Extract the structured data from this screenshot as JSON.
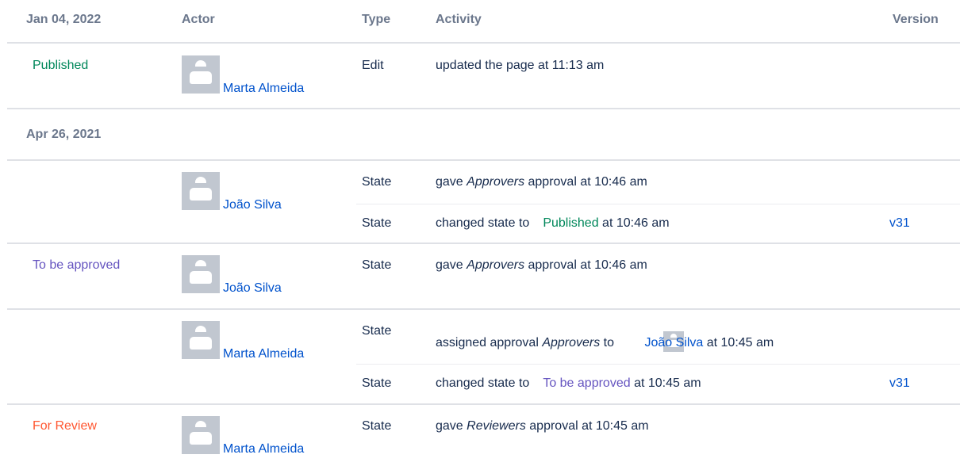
{
  "header": {
    "date": "Jan 04, 2022",
    "actor": "Actor",
    "type": "Type",
    "activity": "Activity",
    "version": "Version"
  },
  "group2_date": "Apr 26, 2021",
  "rows": [
    {
      "status": "Published",
      "actor": "Marta Almeida",
      "type": "Edit",
      "activity": "updated the page at 11:13 am"
    },
    {
      "actor": "João Silva",
      "entries": [
        {
          "type": "State",
          "pre": "gave ",
          "em": "Approvers",
          "post": " approval at 10:46 am"
        },
        {
          "type": "State",
          "pre": "changed state to",
          "state": "Published",
          "post": " at 10:46 am",
          "version": "v31"
        }
      ]
    },
    {
      "status": "To be approved",
      "actor": "João Silva",
      "entries": [
        {
          "type": "State",
          "pre": "gave ",
          "em": "Approvers",
          "post": " approval at 10:46 am"
        }
      ]
    },
    {
      "actor": "Marta Almeida",
      "entries": [
        {
          "type": "State",
          "pre": "assigned approval ",
          "em": "Approvers",
          "mid": " to ",
          "user": "João Silva",
          "post": " at 10:45 am"
        },
        {
          "type": "State",
          "pre": "changed state to",
          "state": "To be approved",
          "post": " at 10:45 am",
          "version": "v31"
        }
      ]
    },
    {
      "status": "For Review",
      "actor": "Marta Almeida",
      "entries": [
        {
          "type": "State",
          "pre": "gave ",
          "em": "Reviewers",
          "post": " approval at 10:45 am"
        }
      ]
    }
  ],
  "colors": {
    "published": "#00875a",
    "to_be_approved": "#6554c0",
    "for_review": "#ff5630",
    "link": "#0052cc",
    "header_text": "#6b778c",
    "avatar_bg": "#c1c7d0"
  },
  "icons": {
    "avatar": "default-user-avatar-icon"
  }
}
